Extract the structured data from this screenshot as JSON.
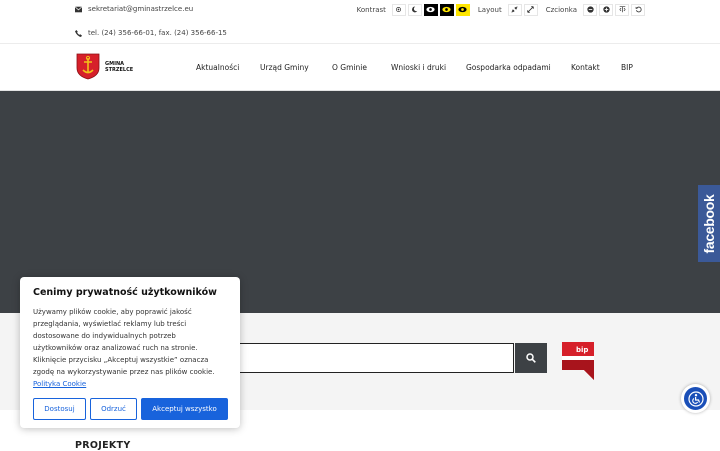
{
  "topbar": {
    "email": "sekretariat@gminastrzelce.eu",
    "phone": "tel. (24) 356-66-01, fax. (24) 356-66-15",
    "contrast_label": "Kontrast",
    "layout_label": "Layout",
    "font_label": "Czcionka"
  },
  "logo": {
    "line1": "GMINA",
    "line2": "STRZELCE"
  },
  "nav": {
    "items": [
      {
        "label": "Aktualności"
      },
      {
        "label": "Urząd Gminy"
      },
      {
        "label": "O Gminie"
      },
      {
        "label": "Wnioski i druki"
      },
      {
        "label": "Gospodarka odpadami"
      },
      {
        "label": "Kontakt"
      },
      {
        "label": "BIP"
      }
    ]
  },
  "facebook": {
    "label": "facebook"
  },
  "search": {
    "value": "",
    "placeholder": ""
  },
  "bip_logo": {
    "label": "bip"
  },
  "section": {
    "title": "PROJEKTY"
  },
  "cookie": {
    "title": "Cenimy prywatność użytkowników",
    "text": "Używamy plików cookie, aby poprawić jakość przeglądania, wyświetlać reklamy lub treści dostosowane do indywidualnych potrzeb użytkowników oraz analizować ruch na stronie. Kliknięcie przycisku „Akceptuj wszystkie” oznacza zgodę na wykorzystywanie przez nas plików cookie.",
    "link": "Polityka Cookie",
    "buttons": {
      "customize": "Dostosuj",
      "reject": "Odrzuć",
      "accept": "Akceptuj wszystko"
    }
  },
  "colors": {
    "accent": "#1863dc",
    "hero": "#3d4145",
    "facebook": "#3b5998",
    "bip_red": "#d6202a"
  }
}
